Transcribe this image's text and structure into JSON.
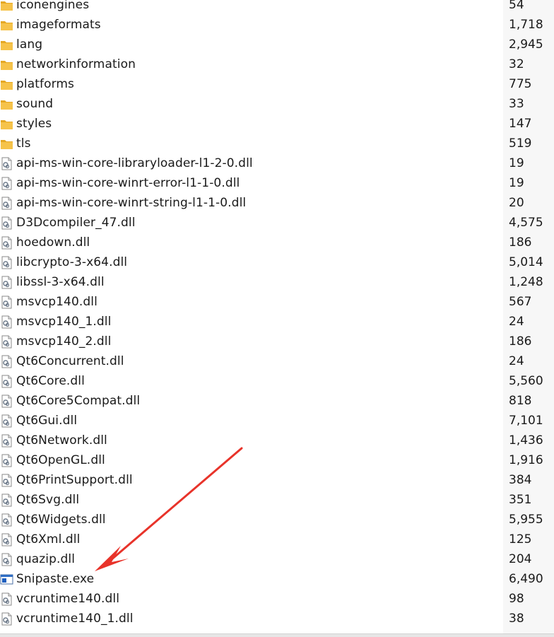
{
  "colors": {
    "folder": "#f6c34a",
    "folder_dark": "#e5a823",
    "arrow": "#e8332a",
    "size_column_bg": "#f7f7f7"
  },
  "files": [
    {
      "name": "iconengines",
      "size": "54",
      "type": "folder"
    },
    {
      "name": "imageformats",
      "size": "1,718",
      "type": "folder"
    },
    {
      "name": "lang",
      "size": "2,945",
      "type": "folder"
    },
    {
      "name": "networkinformation",
      "size": "32",
      "type": "folder"
    },
    {
      "name": "platforms",
      "size": "775",
      "type": "folder"
    },
    {
      "name": "sound",
      "size": "33",
      "type": "folder"
    },
    {
      "name": "styles",
      "size": "147",
      "type": "folder"
    },
    {
      "name": "tls",
      "size": "519",
      "type": "folder"
    },
    {
      "name": "api-ms-win-core-libraryloader-l1-2-0.dll",
      "size": "19",
      "type": "dll"
    },
    {
      "name": "api-ms-win-core-winrt-error-l1-1-0.dll",
      "size": "19",
      "type": "dll"
    },
    {
      "name": "api-ms-win-core-winrt-string-l1-1-0.dll",
      "size": "20",
      "type": "dll"
    },
    {
      "name": "D3Dcompiler_47.dll",
      "size": "4,575",
      "type": "dll"
    },
    {
      "name": "hoedown.dll",
      "size": "186",
      "type": "dll"
    },
    {
      "name": "libcrypto-3-x64.dll",
      "size": "5,014",
      "type": "dll"
    },
    {
      "name": "libssl-3-x64.dll",
      "size": "1,248",
      "type": "dll"
    },
    {
      "name": "msvcp140.dll",
      "size": "567",
      "type": "dll"
    },
    {
      "name": "msvcp140_1.dll",
      "size": "24",
      "type": "dll"
    },
    {
      "name": "msvcp140_2.dll",
      "size": "186",
      "type": "dll"
    },
    {
      "name": "Qt6Concurrent.dll",
      "size": "24",
      "type": "dll"
    },
    {
      "name": "Qt6Core.dll",
      "size": "5,560",
      "type": "dll"
    },
    {
      "name": "Qt6Core5Compat.dll",
      "size": "818",
      "type": "dll"
    },
    {
      "name": "Qt6Gui.dll",
      "size": "7,101",
      "type": "dll"
    },
    {
      "name": "Qt6Network.dll",
      "size": "1,436",
      "type": "dll"
    },
    {
      "name": "Qt6OpenGL.dll",
      "size": "1,916",
      "type": "dll"
    },
    {
      "name": "Qt6PrintSupport.dll",
      "size": "384",
      "type": "dll"
    },
    {
      "name": "Qt6Svg.dll",
      "size": "351",
      "type": "dll"
    },
    {
      "name": "Qt6Widgets.dll",
      "size": "5,955",
      "type": "dll"
    },
    {
      "name": "Qt6Xml.dll",
      "size": "125",
      "type": "dll"
    },
    {
      "name": "quazip.dll",
      "size": "204",
      "type": "dll"
    },
    {
      "name": "Snipaste.exe",
      "size": "6,490",
      "type": "exe"
    },
    {
      "name": "vcruntime140.dll",
      "size": "98",
      "type": "dll"
    },
    {
      "name": "vcruntime140_1.dll",
      "size": "38",
      "type": "dll"
    }
  ]
}
